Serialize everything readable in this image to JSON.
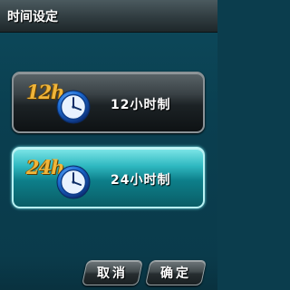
{
  "window": {
    "title": "时间设定"
  },
  "options": [
    {
      "badge": "12h",
      "label": "12小时制",
      "selected": false
    },
    {
      "badge": "24h",
      "label": "24小时制",
      "selected": true
    }
  ],
  "footer": {
    "cancel_label": "取消",
    "ok_label": "确定"
  },
  "colors": {
    "background": "#0b3d4d",
    "selected_accent": "#2fb8c0",
    "badge": "#f0b53a",
    "clock": "#1f6fd6"
  }
}
